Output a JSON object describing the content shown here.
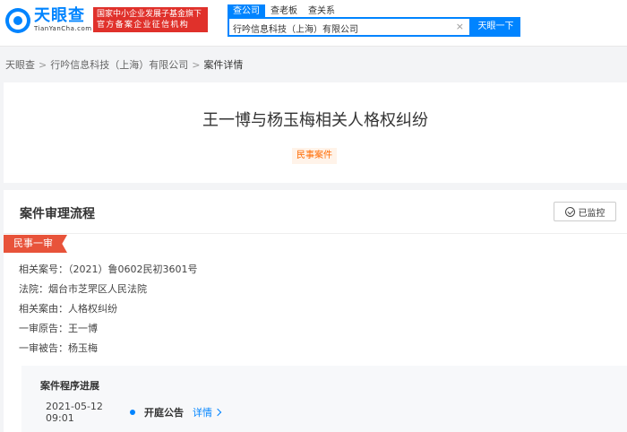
{
  "header": {
    "logo_cn": "天眼查",
    "logo_en": "TianYanCha.com",
    "badge_line1": "国家中小企业发展子基金旗下",
    "badge_line2": "官方备案企业征信机构",
    "search_tabs": [
      "查公司",
      "查老板",
      "查关系"
    ],
    "search_value": "行吟信息科技（上海）有限公司",
    "clear_glyph": "×",
    "search_button": "天眼一下"
  },
  "breadcrumb": {
    "items": [
      "天眼查",
      "行吟信息科技（上海）有限公司",
      "案件详情"
    ],
    "separator": ">"
  },
  "case": {
    "title": "王一博与杨玉梅相关人格权纠纷",
    "tag": "民事案件"
  },
  "process": {
    "title": "案件审理流程",
    "monitor_label": "已监控",
    "stage": "民事一审",
    "info": [
      "相关案号：（2021）鲁0602民初3601号",
      "法院：烟台市芝罘区人民法院",
      "相关案由：人格权纠纷",
      "一审原告：王一博",
      "一审被告：杨玉梅"
    ],
    "progress": {
      "title": "案件程序进展",
      "date": "2021-05-12 09:01",
      "event": "开庭公告",
      "link": "详情"
    }
  },
  "colors": {
    "brand": "#0084ff",
    "badge": "#e0312b",
    "stage_tag": "#e8533a",
    "case_tag_text": "#ff6a00"
  }
}
